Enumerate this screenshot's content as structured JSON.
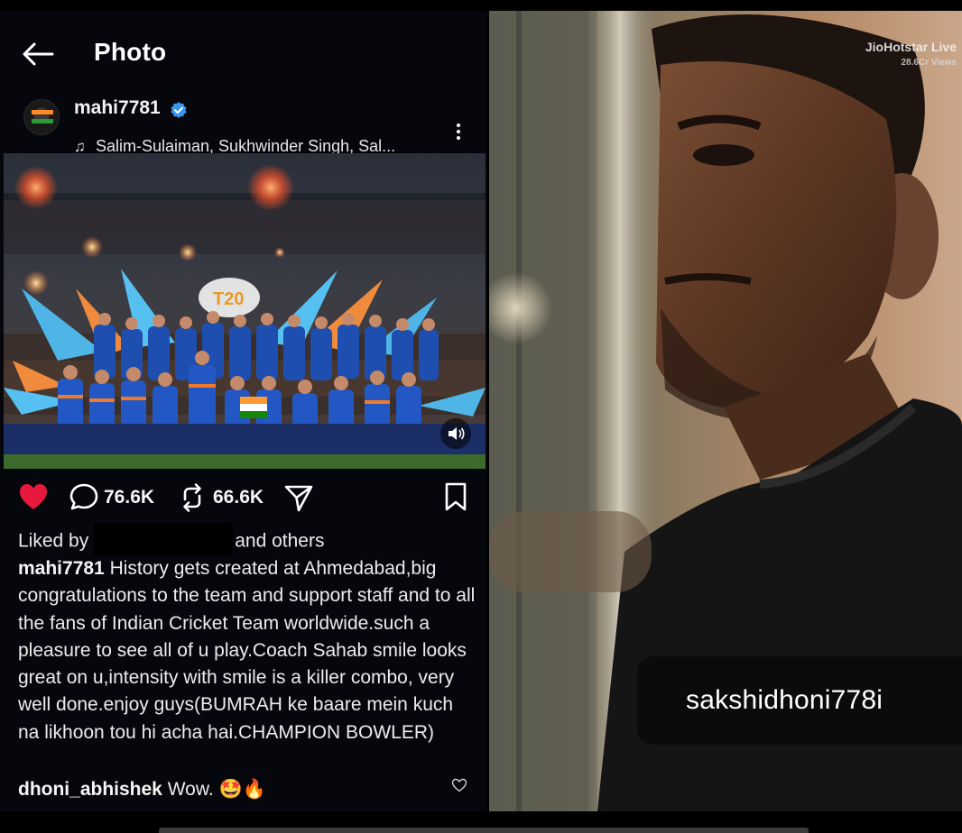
{
  "header": {
    "title": "Photo"
  },
  "post": {
    "username": "mahi7781",
    "audio": "Salim-Sulaiman, Sukhwinder Singh, Sal...",
    "image_overlay_text": "T20",
    "comments_count": "76.6K",
    "reposts_count": "66.6K",
    "liked_by_prefix": "Liked by",
    "liked_by_suffix": "and others",
    "caption_user": "mahi7781",
    "caption_text": " History gets created at Ahmedabad,big congratulations to the team and support staff and to all the fans of Indian Cricket Team worldwide.such a pleasure to see all of u play.Coach Sahab smile looks great on u,intensity with smile is a killer combo, very well done.enjoy guys(BUMRAH ke baare mein kuch na likhoon tou hi acha hai.CHAMPION BOWLER)",
    "comment_user": "dhoni_abhishek",
    "comment_text": " Wow. 🤩🔥"
  },
  "photo": {
    "watermark_brand": "JioHotstar Live",
    "watermark_views": "28.6Cr Views",
    "profile_tag": "sakshidhoni778i"
  },
  "colors": {
    "heart": "#e8193c",
    "verified": "#3897f0",
    "background": "#06070c"
  },
  "icons": [
    "back-arrow-icon",
    "verified-icon",
    "music-note-icon",
    "more-vertical-icon",
    "heart-icon",
    "comment-icon",
    "repost-icon",
    "share-icon",
    "bookmark-icon",
    "sound-icon"
  ]
}
